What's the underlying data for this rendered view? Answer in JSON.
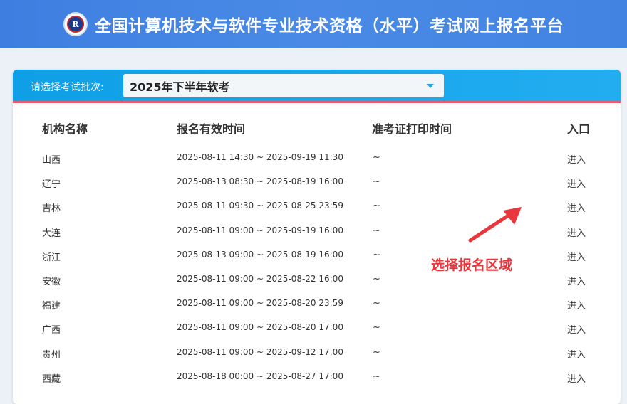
{
  "header": {
    "logo": "kingsoft-seal-logo",
    "title": "全国计算机技术与软件专业技术资格（水平）考试网上报名平台"
  },
  "batch": {
    "label": "请选择考试批次:",
    "selected": "2025年下半年软考"
  },
  "table": {
    "columns": [
      "机构名称",
      "报名有效时间",
      "准考证打印时间",
      "入口"
    ],
    "rows": [
      {
        "org": "山西",
        "period": "2025-08-11 14:30 ~ 2025-09-19 11:30",
        "print": "~",
        "entry": "进入"
      },
      {
        "org": "辽宁",
        "period": "2025-08-13 08:30 ~ 2025-08-19 16:00",
        "print": "~",
        "entry": "进入"
      },
      {
        "org": "吉林",
        "period": "2025-08-11 09:30 ~ 2025-08-25 23:59",
        "print": "~",
        "entry": "进入"
      },
      {
        "org": "大连",
        "period": "2025-08-11 09:00 ~ 2025-09-19 16:00",
        "print": "~",
        "entry": "进入"
      },
      {
        "org": "浙江",
        "period": "2025-08-13 09:00 ~ 2025-08-19 16:00",
        "print": "~",
        "entry": "进入"
      },
      {
        "org": "安徽",
        "period": "2025-08-11 09:00 ~ 2025-08-22 16:00",
        "print": "~",
        "entry": "进入"
      },
      {
        "org": "福建",
        "period": "2025-08-11 09:00 ~ 2025-08-20 23:59",
        "print": "~",
        "entry": "进入"
      },
      {
        "org": "广西",
        "period": "2025-08-11 09:00 ~ 2025-08-20 17:00",
        "print": "~",
        "entry": "进入"
      },
      {
        "org": "贵州",
        "period": "2025-08-11 09:00 ~ 2025-09-12 17:00",
        "print": "~",
        "entry": "进入"
      },
      {
        "org": "西藏",
        "period": "2025-08-18 00:00 ~ 2025-08-27 17:00",
        "print": "~",
        "entry": "进入"
      }
    ]
  },
  "annotation": {
    "text": "选择报名区域",
    "color": "#e8363c"
  },
  "colors": {
    "header": "#4a8ae6",
    "card_bar": "#1aa8ee",
    "accent_line": "#e95c6c"
  }
}
